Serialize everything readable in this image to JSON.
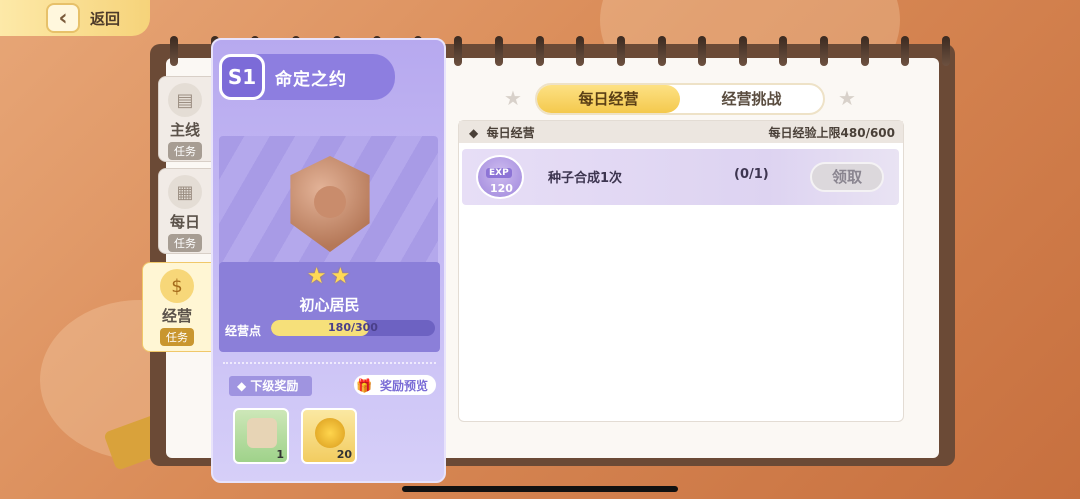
{
  "top_bar": {
    "back_label": "返回"
  },
  "side_tabs": [
    {
      "title": "主线",
      "sub": "任务",
      "icon": "scroll-icon"
    },
    {
      "title": "每日",
      "sub": "任务",
      "icon": "calendar-icon"
    },
    {
      "title": "经营",
      "sub": "任务",
      "icon": "money-bag-icon"
    }
  ],
  "season": {
    "badge": "S1",
    "title": "命定之约",
    "rank_name": "初心居民",
    "stars": 2,
    "exp_label": "经营点",
    "exp_text": "180/300",
    "exp_fraction": 0.6
  },
  "lower_rewards": {
    "title": "下级奖励",
    "preview_label": "奖励预览",
    "items": [
      {
        "count": "1",
        "kind": "map"
      },
      {
        "count": "20",
        "kind": "coin"
      }
    ]
  },
  "tabs": [
    {
      "label": "每日经营",
      "active": true
    },
    {
      "label": "经营挑战",
      "active": false
    }
  ],
  "list": {
    "header_left": "每日经营",
    "header_right": "每日经验上限480/600",
    "tasks": [
      {
        "exp_label": "EXP",
        "exp_value": "120",
        "name": "种子合成1次",
        "progress": "(0/1)",
        "button": "领取"
      }
    ]
  }
}
